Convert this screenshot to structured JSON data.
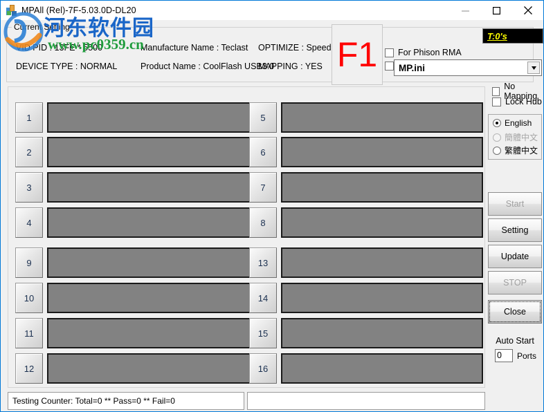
{
  "window": {
    "title": "MPAll (Rel)-7F-5.03.0D-DL20",
    "icon": "app-icon",
    "minimize": "—",
    "maximize": "☐",
    "close": "✕"
  },
  "current_setting": {
    "group_title": "Current Setting",
    "vid_pid": "VID PID : 13FE * 5500",
    "device_type": "DEVICE TYPE : NORMAL",
    "manufacture_name": "Manufacture Name : Teclast",
    "product_name": "Product Name : CoolFlash USB3.0",
    "optimize": "OPTIMIZE : Speed",
    "mapping": "MAPPING : YES"
  },
  "status_indicator": {
    "firmware_label": "F1",
    "firmware_color": "#ff0000",
    "timer": "T:0's",
    "timer_color": "#ffff00",
    "timer_background": "#000000"
  },
  "options": {
    "phison_rma": {
      "label": "For Phison RMA",
      "checked": false
    },
    "ini_checkbox": {
      "checked": false
    },
    "ini_file": {
      "value": "MP.ini",
      "arrow": "▼"
    },
    "no_mapping": {
      "label": "No Mapping",
      "checked": false
    },
    "lock_hub": {
      "label": "Lock Hub",
      "checked": false
    }
  },
  "language": {
    "options": [
      {
        "label": "English",
        "selected": true,
        "disabled": false
      },
      {
        "label": "簡體中文",
        "selected": false,
        "disabled": true
      },
      {
        "label": "繁體中文",
        "selected": false,
        "disabled": false
      }
    ]
  },
  "buttons": {
    "start": {
      "label": "Start",
      "disabled": true
    },
    "setting": {
      "label": "Setting",
      "disabled": false
    },
    "update": {
      "label": "Update",
      "disabled": false
    },
    "stop": {
      "label": "STOP",
      "disabled": true
    },
    "close": {
      "label": "Close",
      "disabled": false,
      "focused": true
    }
  },
  "auto_start": {
    "label": "Auto Start",
    "value": "0",
    "unit": "Ports"
  },
  "ports": {
    "left_top": [
      "1",
      "2",
      "3",
      "4"
    ],
    "right_top": [
      "5",
      "6",
      "7",
      "8"
    ],
    "left_bottom": [
      "9",
      "10",
      "11",
      "12"
    ],
    "right_bottom": [
      "13",
      "14",
      "15",
      "16"
    ],
    "status_text": ""
  },
  "status_bars": {
    "left": "Testing Counter: Total=0 ** Pass=0 ** Fail=0",
    "right": ""
  },
  "watermark": {
    "site_name": "河东软件园",
    "url": "www.pc0359.cn",
    "site_color": "#1a66c8",
    "url_color": "#1f9c3c"
  }
}
